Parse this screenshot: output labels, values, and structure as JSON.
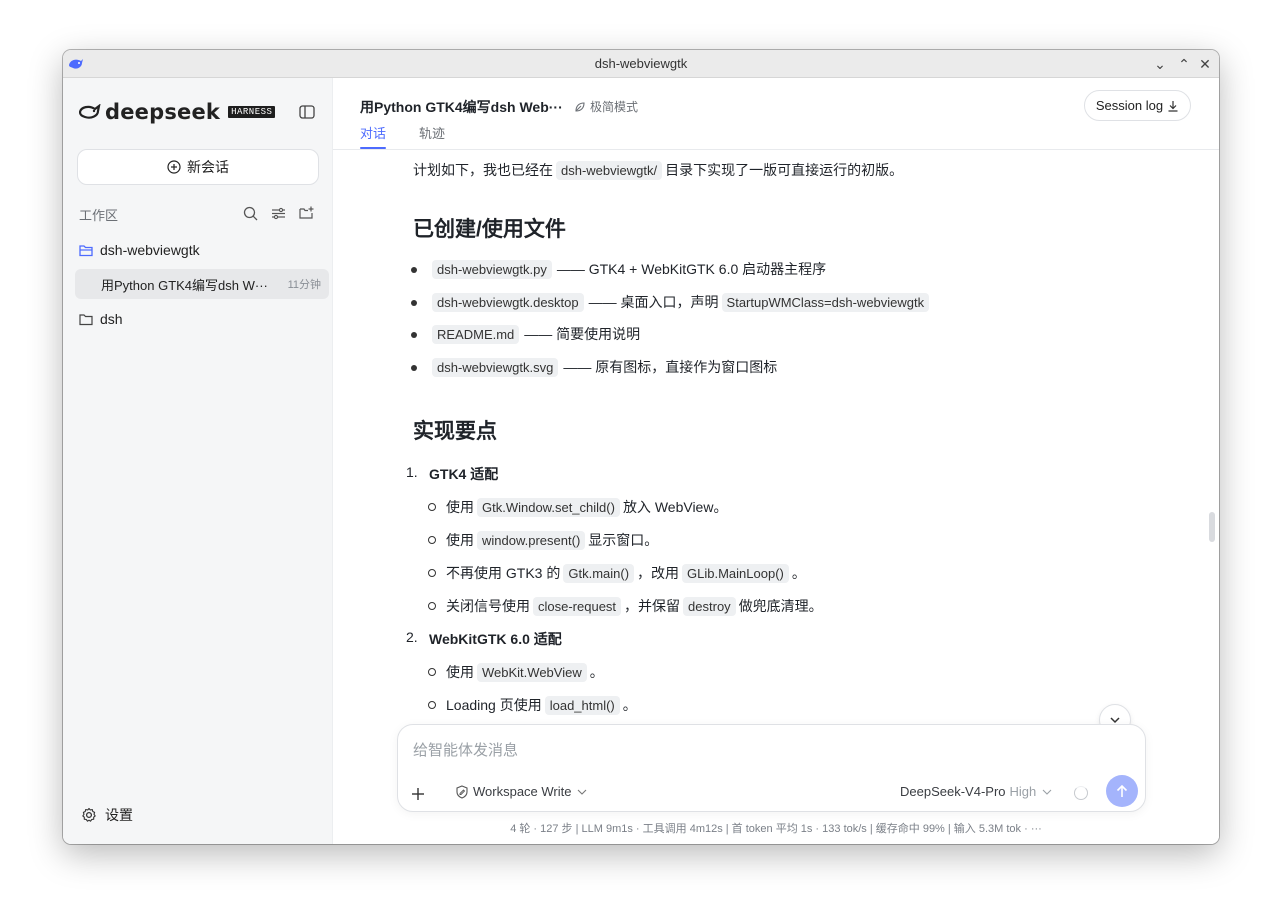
{
  "window": {
    "title": "dsh-webviewgtk"
  },
  "sidebar": {
    "logo_text": "deepseek",
    "logo_badge": "HARNESS",
    "new_chat_label": "新会话",
    "workspace_label": "工作区",
    "project_name": "dsh-webviewgtk",
    "session_title": "用Python GTK4编写dsh W···",
    "session_time": "11分钟",
    "folder_name": "dsh",
    "settings_label": "设置"
  },
  "header": {
    "conversation_title": "用Python GTK4编写dsh Web···",
    "minimal_mode_label": "极简模式",
    "session_log_label": "Session log",
    "tabs": [
      {
        "label": "对话",
        "active": true
      },
      {
        "label": "轨迹",
        "active": false
      }
    ]
  },
  "message": {
    "intro_before": "计划如下，我也已经在",
    "intro_code": "dsh-webviewgtk/",
    "intro_after": "目录下实现了一版可直接运行的初版。",
    "section1_heading": "已创建/使用文件",
    "files": [
      {
        "code": "dsh-webviewgtk.py",
        "desc": "—— GTK4 + WebKitGTK 6.0 启动器主程序"
      },
      {
        "code": "dsh-webviewgtk.desktop",
        "desc": "—— 桌面入口，声明",
        "code2": "StartupWMClass=dsh-webviewgtk"
      },
      {
        "code": "README.md",
        "desc": "—— 简要使用说明"
      },
      {
        "code": "dsh-webviewgtk.svg",
        "desc": "—— 原有图标，直接作为窗口图标"
      }
    ],
    "section2_heading": "实现要点",
    "point1_num": "1.",
    "point1_title": "GTK4 适配",
    "point1_items": [
      {
        "pre": "使用",
        "code": "Gtk.Window.set_child()",
        "post": "放入 WebView。"
      },
      {
        "pre": "使用",
        "code": "window.present()",
        "post": "显示窗口。"
      },
      {
        "pre": "不再使用 GTK3 的",
        "code": "Gtk.main()",
        "mid": "，改用",
        "code2": "GLib.MainLoop()",
        "post": "。"
      },
      {
        "pre": "关闭信号使用",
        "code": "close-request",
        "mid": "，并保留",
        "code2": "destroy",
        "post": "做兜底清理。"
      }
    ],
    "point2_num": "2.",
    "point2_title": "WebKitGTK 6.0 适配",
    "point2_items": [
      {
        "pre": "使用",
        "code": "WebKit.WebView",
        "post": "。"
      },
      {
        "pre": "Loading 页使用",
        "code": "load_html()",
        "post": "。"
      }
    ]
  },
  "composer": {
    "placeholder": "给智能体发消息",
    "workspace_mode": "Workspace Write",
    "model": "DeepSeek-V4-Pro",
    "effort": "High"
  },
  "stats": "4 轮 · 127 步  |  LLM 9m1s · 工具调用 4m12s  |  首 token 平均 1s · 133 tok/s  |  缓存命中 99%  |  输入 5.3M tok · ···",
  "colors": {
    "accent": "#4d6bfe",
    "send_button": "#a4b4fc",
    "sidebar_bg": "#f5f6f7"
  }
}
